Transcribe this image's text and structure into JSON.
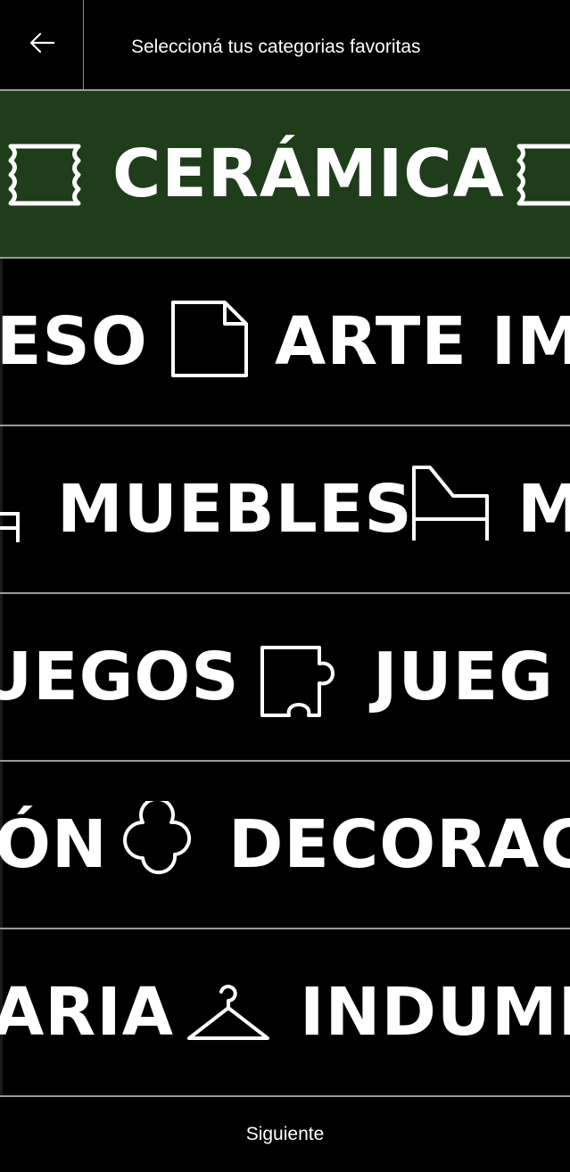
{
  "header": {
    "title": "Seleccioná tus categorias favoritas",
    "back_icon": "arrow-left-icon"
  },
  "categories": [
    {
      "visible_text": [
        "CERÁMICA"
      ],
      "icon": "ceramic-tile-icon",
      "selected": true
    },
    {
      "visible_text": [
        "ESO",
        "ARTE IM"
      ],
      "icon": "paper-sheet-icon",
      "selected": false
    },
    {
      "visible_text": [
        "MUEBLES",
        "M"
      ],
      "icon": "chair-icon",
      "selected": false
    },
    {
      "visible_text": [
        "UEGOS",
        "JUEG"
      ],
      "icon": "puzzle-piece-icon",
      "selected": false
    },
    {
      "visible_text": [
        "ÓN",
        "DECORAC"
      ],
      "icon": "quatrefoil-icon",
      "selected": false
    },
    {
      "visible_text": [
        "ARIA",
        "INDUME"
      ],
      "icon": "hanger-icon",
      "selected": false
    }
  ],
  "footer": {
    "next_label": "Siguiente"
  },
  "colors": {
    "background": "#000000",
    "selected_row": "#1f3d1a",
    "text": "#ffffff",
    "divider": "#9a9a9a"
  }
}
